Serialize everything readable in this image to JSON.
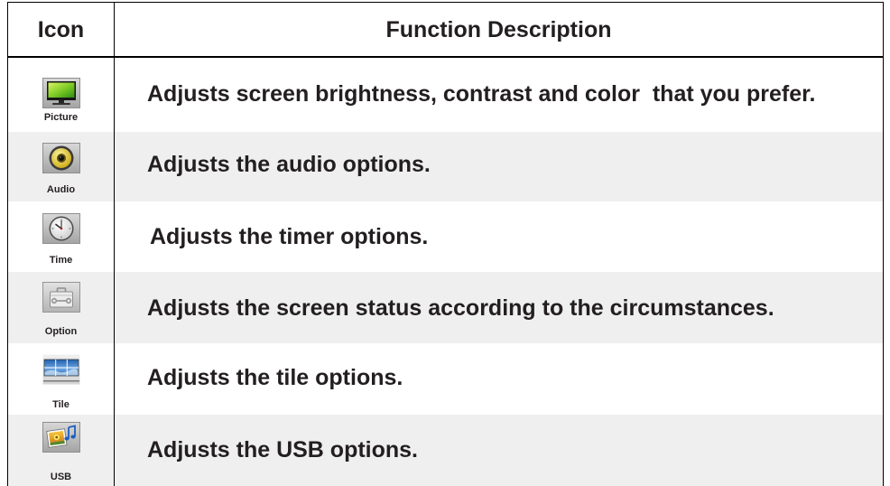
{
  "table": {
    "headers": [
      "Icon",
      "Function Description"
    ],
    "rows": [
      {
        "icon": "picture-icon",
        "label": "Picture",
        "description": "Adjusts screen brightness, contrast and color  that you prefer."
      },
      {
        "icon": "audio-icon",
        "label": "Audio",
        "description": "Adjusts the audio options."
      },
      {
        "icon": "time-icon",
        "label": "Time",
        "description": "Adjusts the timer options."
      },
      {
        "icon": "option-icon",
        "label": "Option",
        "description": "Adjusts the screen status according to the circumstances."
      },
      {
        "icon": "tile-icon",
        "label": "Tile",
        "description": "Adjusts the tile options."
      },
      {
        "icon": "usb-icon",
        "label": "USB",
        "description": "Adjusts the USB options."
      }
    ]
  },
  "colors": {
    "border": "#000000",
    "row_shade": "#efefef",
    "text": "#231f20"
  }
}
